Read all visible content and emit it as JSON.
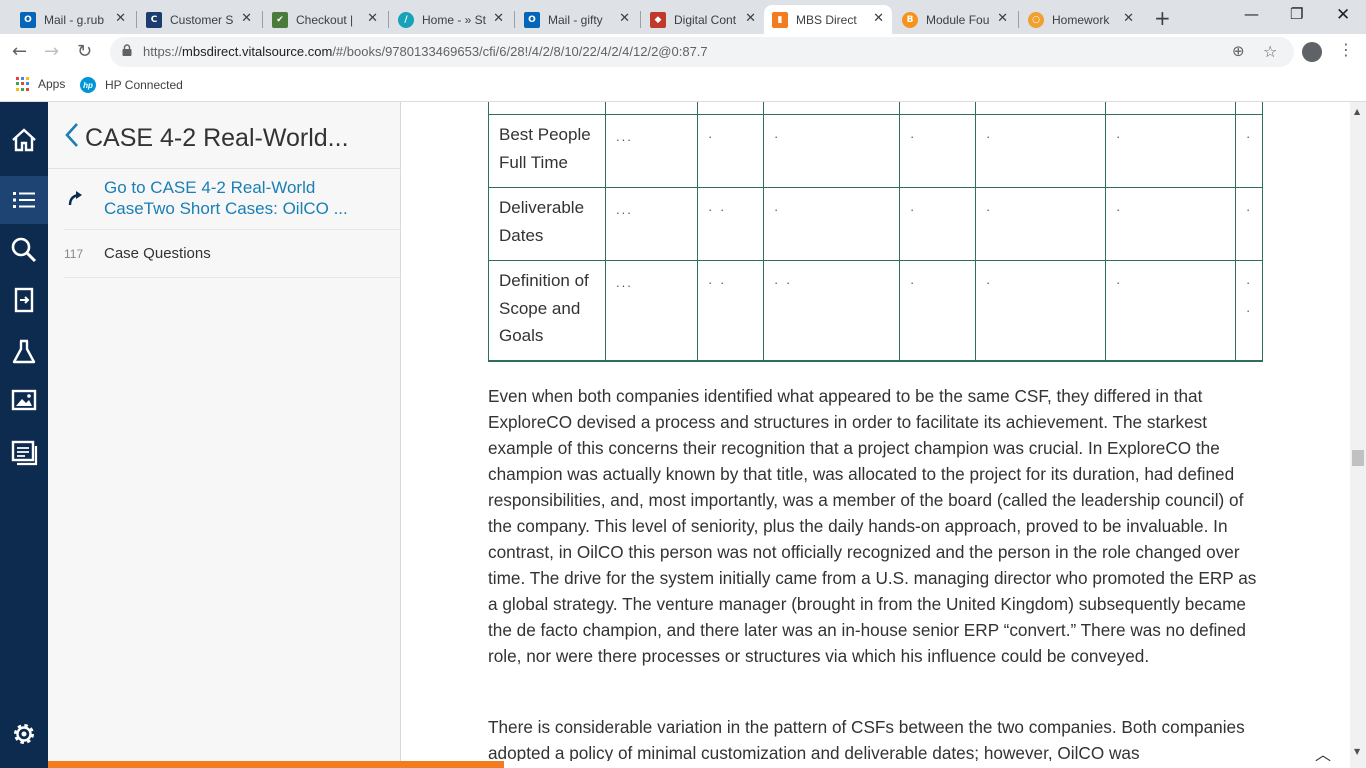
{
  "browser": {
    "tabs": [
      {
        "title": "Mail - g.rub",
        "icon": "outlook-icon",
        "color": "#0364b8",
        "glyph": "O"
      },
      {
        "title": "Customer S",
        "icon": "customer-service-icon",
        "color": "#1a3d6e",
        "glyph": "C"
      },
      {
        "title": "Checkout |",
        "icon": "checkout-icon",
        "color": "#4a7b3a",
        "glyph": "✔"
      },
      {
        "title": "Home - » St",
        "icon": "home-site-icon",
        "color": "#17a2b8",
        "glyph": "/"
      },
      {
        "title": "Mail - gifty",
        "icon": "outlook-icon",
        "color": "#0364b8",
        "glyph": "O"
      },
      {
        "title": "Digital Cont",
        "icon": "book-icon",
        "color": "#c0392b",
        "glyph": "◆"
      },
      {
        "title": "MBS Direct",
        "icon": "mbs-icon",
        "color": "#f47c20",
        "glyph": "▮",
        "active": true
      },
      {
        "title": "Module Fou",
        "icon": "bitcoin-icon",
        "color": "#f7931a",
        "glyph": "B"
      },
      {
        "title": "Homework",
        "icon": "homework-icon",
        "color": "#f0a030",
        "glyph": "○"
      }
    ],
    "new_tab_glyph": "+",
    "close_glyph": "✕",
    "window_controls": {
      "minimize": "—",
      "maximize": "❐",
      "close": "✕"
    },
    "url_prefix": "https://",
    "url_host": "mbsdirect.vitalsource.com",
    "url_path": "/#/books/9780133469653/cfi/6/28!/4/2/8/10/22/4/2/4/12/2@0:87.7",
    "bookmarks": [
      {
        "label": "Apps",
        "icon": "apps-grid-icon"
      },
      {
        "label": "HP Connected",
        "icon": "hp-logo-icon",
        "logo_text": "hp"
      }
    ]
  },
  "toc": {
    "title": "CASE 4-2 Real-World...",
    "goto_label": "Go to CASE 4-2 Real-World CaseTwo Short Cases: OilCO ...",
    "items": [
      {
        "page": "117",
        "label": "Case Questions"
      }
    ]
  },
  "table": {
    "rows": [
      {
        "label": "",
        "cells": [
          "",
          "",
          "",
          "",
          "",
          "",
          "",
          ""
        ]
      },
      {
        "label": "Best People Full Time",
        "cells": [
          "...",
          "·",
          "·",
          "·",
          "·",
          "·",
          "·"
        ]
      },
      {
        "label": "Deliverable Dates",
        "cells": [
          "...",
          "· ·",
          "·",
          "·",
          "·",
          "·",
          "·"
        ]
      },
      {
        "label": "Definition of Scope and Goals",
        "cells": [
          "...",
          "· ·",
          "· ·",
          "·",
          "·",
          "·",
          "· ·"
        ]
      }
    ]
  },
  "content": {
    "paragraph1": "Even when both companies identified what appeared to be the same CSF, they differed in that ExploreCO devised a process and structures in order to facilitate its achievement. The starkest example of this concerns their recognition that a project champion was crucial. In ExploreCO the champion was actually known by that title, was allocated to the project for its duration, had defined responsibilities, and, most importantly, was a member of the board (called the leadership council) of the company. This level of seniority, plus the daily hands-on approach, proved to be invaluable. In contrast, in OilCO this person was not officially recognized and the person in the role changed over time. The drive for the system initially came from a U.S. managing director who promoted the ERP as a global strategy. The venture manager (brought in from the United Kingdom) subsequently became the de facto champion, and there later was an in-house senior ERP “convert.” There was no defined role, nor were there processes or structures via which his influence could be conveyed.",
    "paragraph2": "There is considerable variation in the pattern of CSFs between the two companies. Both companies adopted a policy of minimal customization and deliverable dates; however, OilCO was"
  },
  "reader": {
    "progress_fraction": 0.35,
    "accent_color": "#f47c20",
    "rail_color": "#0d2a4f"
  }
}
